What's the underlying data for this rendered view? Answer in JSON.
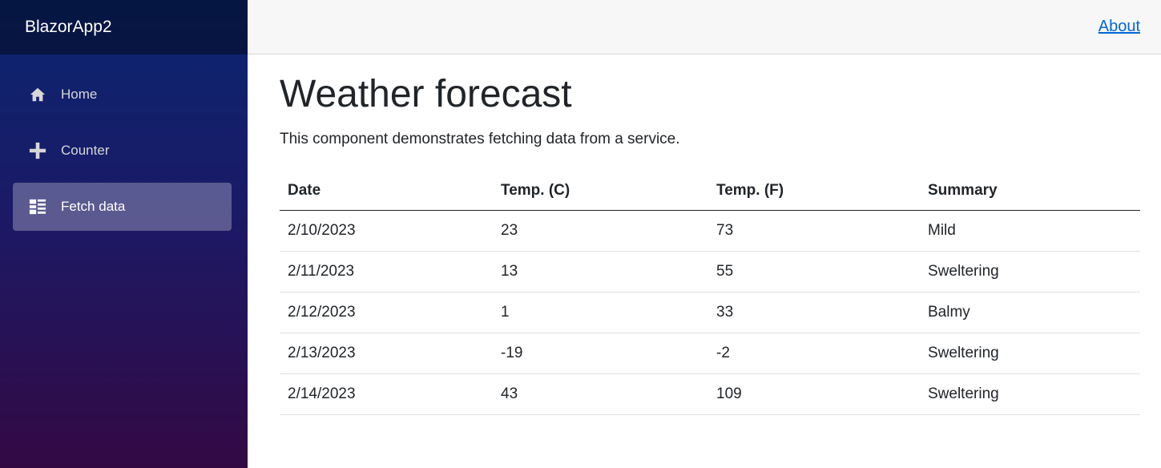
{
  "brand": "BlazorApp2",
  "nav": {
    "items": [
      {
        "label": "Home",
        "icon": "home-icon"
      },
      {
        "label": "Counter",
        "icon": "plus-icon"
      },
      {
        "label": "Fetch data",
        "icon": "list-icon",
        "active": true
      }
    ]
  },
  "top_row": {
    "about_label": "About"
  },
  "page": {
    "title": "Weather forecast",
    "description": "This component demonstrates fetching data from a service."
  },
  "table": {
    "headers": [
      "Date",
      "Temp. (C)",
      "Temp. (F)",
      "Summary"
    ],
    "rows": [
      [
        "2/10/2023",
        "23",
        "73",
        "Mild"
      ],
      [
        "2/11/2023",
        "13",
        "55",
        "Sweltering"
      ],
      [
        "2/12/2023",
        "1",
        "33",
        "Balmy"
      ],
      [
        "2/13/2023",
        "-19",
        "-2",
        "Sweltering"
      ],
      [
        "2/14/2023",
        "43",
        "109",
        "Sweltering"
      ]
    ]
  },
  "colors": {
    "sidebar_top": "#0a2670",
    "sidebar_bottom": "#330944",
    "link": "#0366d6",
    "top_row_bg": "#f7f7f7"
  }
}
